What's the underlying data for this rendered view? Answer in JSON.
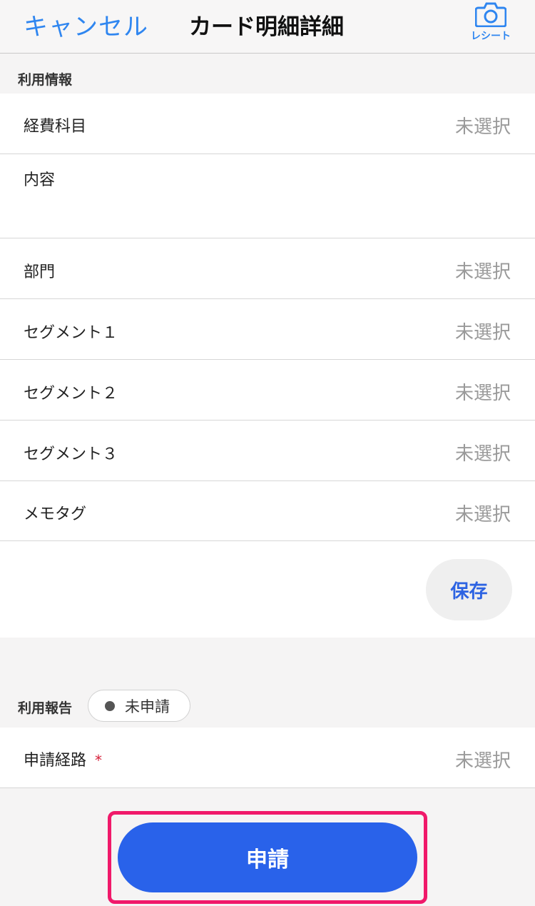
{
  "header": {
    "cancel_label": "キャンセル",
    "title": "カード明細詳細",
    "receipt_label": "レシート",
    "accent_color": "#2f86f0"
  },
  "usage_info": {
    "section_label": "利用情報",
    "rows": [
      {
        "label": "経費科目",
        "value": "未選択"
      },
      {
        "label": "内容",
        "value": ""
      },
      {
        "label": "部門",
        "value": "未選択"
      },
      {
        "label": "セグメント１",
        "value": "未選択"
      },
      {
        "label": "セグメント２",
        "value": "未選択"
      },
      {
        "label": "セグメント３",
        "value": "未選択"
      },
      {
        "label": "メモタグ",
        "value": "未選択"
      }
    ],
    "save_label": "保存"
  },
  "usage_report": {
    "section_label": "利用報告",
    "status": "未申請",
    "route_label": "申請経路",
    "required_mark": "*",
    "route_value": "未選択"
  },
  "submit": {
    "label": "申請",
    "color": "#2962ea",
    "highlight_color": "#f0196a"
  }
}
